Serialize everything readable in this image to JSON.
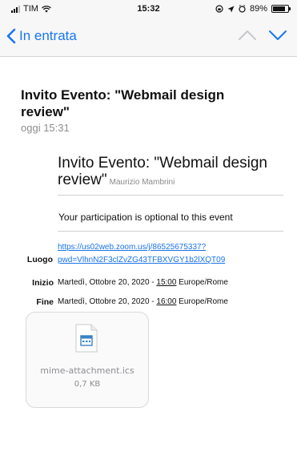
{
  "status_bar": {
    "carrier": "TIM",
    "time": "15:32",
    "battery": "89%"
  },
  "nav": {
    "back_label": "In entrata"
  },
  "email": {
    "subject": "Invito Evento: \"Webmail design review\"",
    "date": "oggi 15:31"
  },
  "invite": {
    "title": "Invito Evento: \"Webmail design review\"",
    "organizer": "Maurizio Mambrini",
    "optional_notice": "Your participation is optional to this event",
    "location_label": "Luogo",
    "location_url_line1": "https://us02web.zoom.us/j/86525675337?",
    "location_url_line2": "pwd=VlhnN2F3clZvZG43TFBXVGY1b2lXQT09",
    "start_label": "Inizio",
    "start_prefix": "Martedì, Ottobre 20, 2020 - ",
    "start_time": "15:00",
    "start_suffix": " Europe/Rome",
    "end_label": "Fine",
    "end_prefix": "Martedì, Ottobre 20, 2020 - ",
    "end_time": "16:00",
    "end_suffix": " Europe/Rome"
  },
  "attachment": {
    "filename": "mime-attachment.ics",
    "size": "0,7 KB"
  },
  "colors": {
    "accent": "#1877f2",
    "link": "#1a73e8",
    "muted": "#8e8e93"
  }
}
